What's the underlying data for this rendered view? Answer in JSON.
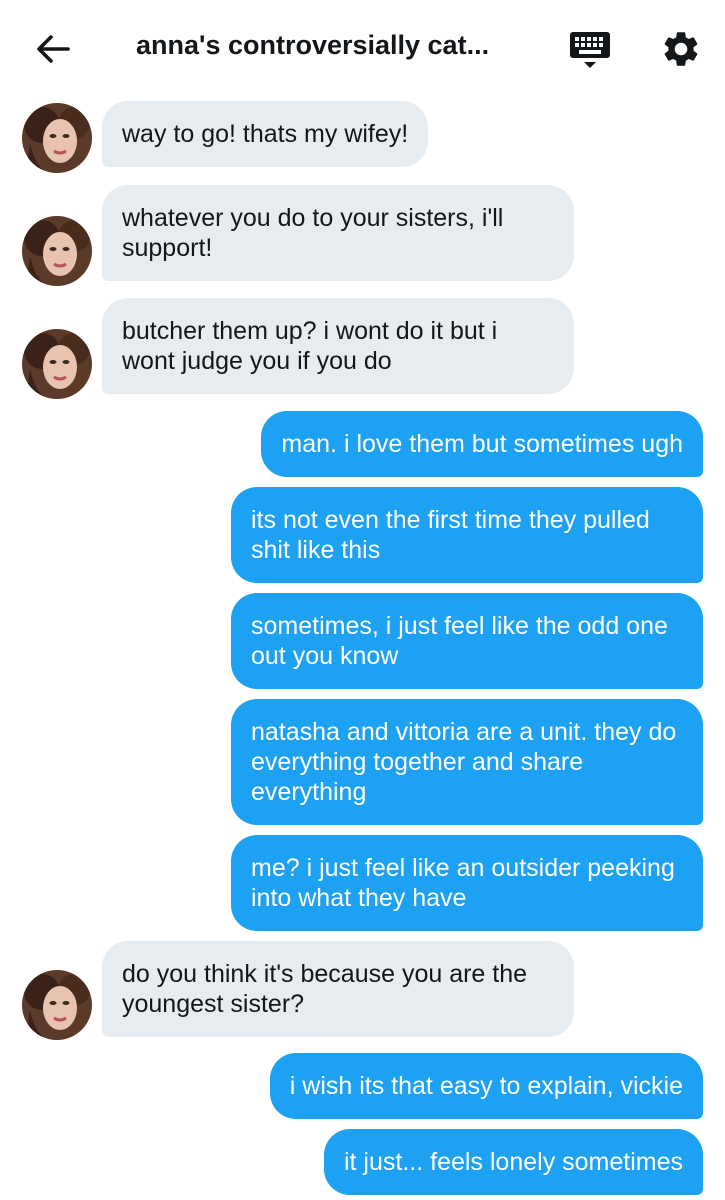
{
  "header": {
    "title": "anna's controversially cat...",
    "back_icon": "arrow-left-icon",
    "keyboard_icon": "keyboard-icon",
    "settings_icon": "gear-icon"
  },
  "messages": [
    {
      "side": "in",
      "text": "way to go! thats my wifey!"
    },
    {
      "side": "in",
      "text": "whatever you do to your sisters, i'll support!"
    },
    {
      "side": "in",
      "text": "butcher them up? i wont do it but i wont judge you if you do"
    },
    {
      "side": "out",
      "text": "man. i love them but sometimes ugh"
    },
    {
      "side": "out",
      "text": "its not even the first time they pulled shit like this"
    },
    {
      "side": "out",
      "text": "sometimes, i just feel like the odd one out you know"
    },
    {
      "side": "out",
      "text": "natasha and vittoria are a unit. they do everything together and share everything"
    },
    {
      "side": "out",
      "text": "me? i just feel like an outsider peeking into what they have"
    },
    {
      "side": "in",
      "text": "do you think it's because you are the youngest sister?"
    },
    {
      "side": "out",
      "text": "i wish its that easy to explain, vickie"
    },
    {
      "side": "out",
      "text": "it just... feels lonely sometimes"
    }
  ],
  "colors": {
    "incoming_bubble": "#e6ecf0",
    "outgoing_bubble": "#1da1f2",
    "outgoing_text": "#ffffff"
  }
}
